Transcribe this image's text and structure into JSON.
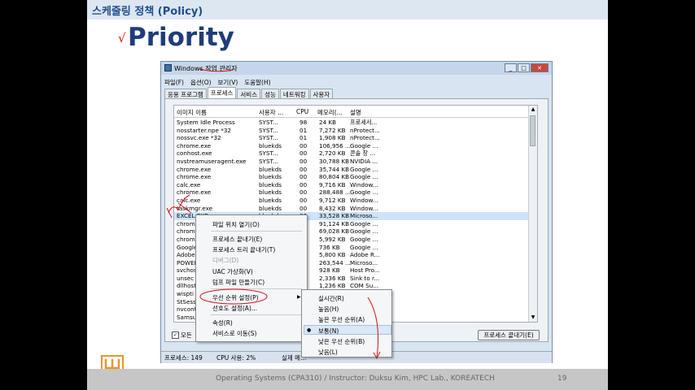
{
  "slide": {
    "section_title": "스케줄링 정책 (Policy)",
    "title": "Priority",
    "footer": "Operating Systems (CPA310) / Instructor: Duksu Kim, HPC Lab., KOREATECH",
    "page_number": "19"
  },
  "window": {
    "title": "Windows 작업 관리자",
    "menu": [
      "파일(F)",
      "옵션(O)",
      "보기(V)",
      "도움말(H)"
    ],
    "tabs": [
      "응용 프로그램",
      "프로세스",
      "서비스",
      "성능",
      "네트워킹",
      "사용자"
    ],
    "active_tab": 1,
    "columns": [
      "이미지 이름",
      "사용자 ...",
      "CPU",
      "메모리(...",
      "설명"
    ],
    "rows": [
      {
        "name": "System Idle Process",
        "user": "SYST...",
        "cpu": "98",
        "mem": "24 KB",
        "desc": "프로세서..."
      },
      {
        "name": "nosstarter.npe *32",
        "user": "SYST...",
        "cpu": "01",
        "mem": "7,272 KB",
        "desc": "nProtect..."
      },
      {
        "name": "nossvc.exe *32",
        "user": "SYST...",
        "cpu": "01",
        "mem": "1,908 KB",
        "desc": "nProtect..."
      },
      {
        "name": "chrome.exe",
        "user": "bluekds",
        "cpu": "00",
        "mem": "106,956 ...",
        "desc": "Google ..."
      },
      {
        "name": "conhost.exe",
        "user": "SYST...",
        "cpu": "00",
        "mem": "2,720 KB",
        "desc": "콘솔 창 ..."
      },
      {
        "name": "nvstreamuseragent.exe",
        "user": "SYST...",
        "cpu": "00",
        "mem": "30,788 KB",
        "desc": "NVIDIA ..."
      },
      {
        "name": "chrome.exe",
        "user": "bluekds",
        "cpu": "00",
        "mem": "35,744 KB",
        "desc": "Google ..."
      },
      {
        "name": "chrome.exe",
        "user": "bluekds",
        "cpu": "00",
        "mem": "80,804 KB",
        "desc": "Google ..."
      },
      {
        "name": "calc.exe",
        "user": "bluekds",
        "cpu": "00",
        "mem": "9,716 KB",
        "desc": "Window..."
      },
      {
        "name": "chrome.exe",
        "user": "bluekds",
        "cpu": "00",
        "mem": "288,488 ...",
        "desc": "Google ..."
      },
      {
        "name": "calc.exe",
        "user": "bluekds",
        "cpu": "00",
        "mem": "9,712 KB",
        "desc": "Window..."
      },
      {
        "name": "taskmgr.exe",
        "user": "bluekds",
        "cpu": "00",
        "mem": "8,432 KB",
        "desc": "Window..."
      },
      {
        "name": "EXCEL.EXE",
        "user": "bluekds",
        "cpu": "00",
        "mem": "33,528 KB",
        "desc": "Microso..."
      },
      {
        "name": "chrom",
        "user": "",
        "cpu": "00",
        "mem": "91,124 KB",
        "desc": "Google ..."
      },
      {
        "name": "chrom",
        "user": "",
        "cpu": "00",
        "mem": "69,028 KB",
        "desc": "Google ..."
      },
      {
        "name": "chrom",
        "user": "",
        "cpu": "00",
        "mem": "5,992 KB",
        "desc": "Google ..."
      },
      {
        "name": "Google",
        "user": "",
        "cpu": "00",
        "mem": "736 KB",
        "desc": "Google ..."
      },
      {
        "name": "Adobe",
        "user": "",
        "cpu": "00",
        "mem": "5,800 KB",
        "desc": "Adobe R..."
      },
      {
        "name": "POWEI",
        "user": "",
        "cpu": "00",
        "mem": "263,544 ...",
        "desc": "Microso..."
      },
      {
        "name": "svchos",
        "user": "",
        "cpu": "00",
        "mem": "928 KB",
        "desc": "Host Pro..."
      },
      {
        "name": "unsec",
        "user": "",
        "cpu": "00",
        "mem": "2,336 KB",
        "desc": "Sink to r..."
      },
      {
        "name": "dllhost",
        "user": "",
        "cpu": "00",
        "mem": "1,236 KB",
        "desc": "COM Su..."
      },
      {
        "name": "wispti",
        "user": "",
        "cpu": "",
        "mem": "",
        "desc": ""
      },
      {
        "name": "StSess",
        "user": "",
        "cpu": "",
        "mem": "",
        "desc": ""
      },
      {
        "name": "nvcont",
        "user": "",
        "cpu": "",
        "mem": "",
        "desc": ""
      },
      {
        "name": "Samsu",
        "user": "",
        "cpu": "",
        "mem": "",
        "desc": ""
      }
    ],
    "show_all_label": "모든",
    "end_process_button": "프로세스 끝내기(E)",
    "status": {
      "processes": "프로세스: 149",
      "cpu_usage": "CPU 사용: 2%",
      "memory": "실제 메..."
    }
  },
  "context_menu": {
    "items": [
      "파일 위치 열기(O)",
      "프로세스 끝내기(E)",
      "프로세스 트리 끝내기(T)",
      "디버그(D)",
      "UAC 가상화(V)",
      "덤프 파일 만들기(C)",
      "우선 순위 설정(P)",
      "선호도 설정(A)...",
      "속성(R)",
      "서비스로 이동(S)"
    ]
  },
  "priority_menu": {
    "items": [
      "실시간(R)",
      "높음(H)",
      "높은 우선 순위(A)",
      "보통(N)",
      "낮은 우선 순위(B)",
      "낮음(L)"
    ],
    "selected_index": 3
  },
  "colors": {
    "header_band": "#dde7f2",
    "title_blue": "#1f3d7a",
    "annotation_red": "#d11111",
    "logo_orange": "#e8962e"
  }
}
